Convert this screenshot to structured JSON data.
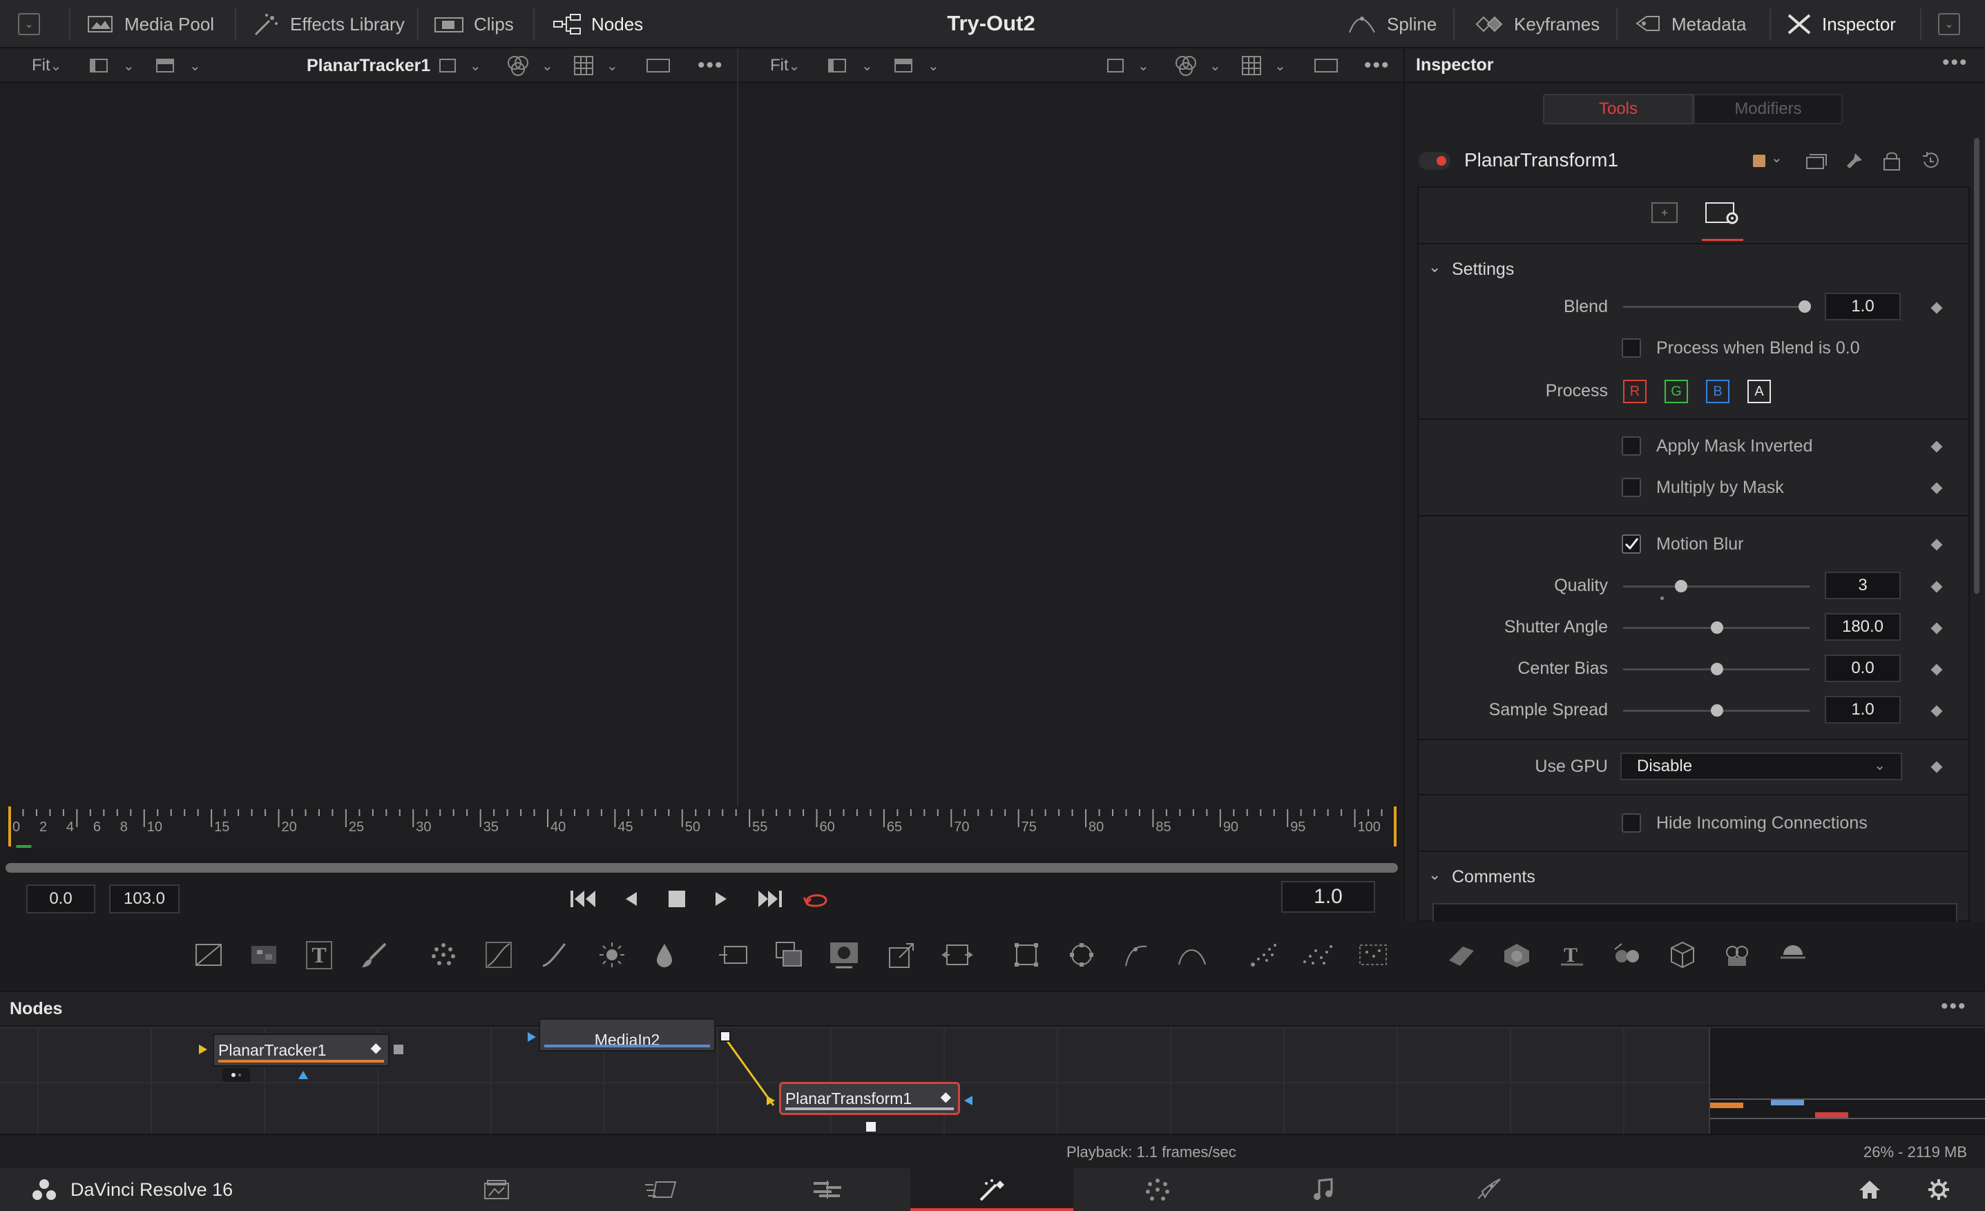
{
  "app": {
    "title": "Try-Out2",
    "name": "DaVinci Resolve 16"
  },
  "topbar": {
    "media_pool": "Media Pool",
    "effects_library": "Effects Library",
    "clips": "Clips",
    "nodes": "Nodes",
    "spline": "Spline",
    "keyframes": "Keyframes",
    "metadata": "Metadata",
    "inspector": "Inspector"
  },
  "viewer_left": {
    "fit": "Fit",
    "name": "PlanarTracker1"
  },
  "viewer_right": {
    "fit": "Fit"
  },
  "timeline": {
    "ticks": [
      "0",
      "2",
      "4",
      "6",
      "8",
      "10",
      "15",
      "20",
      "25",
      "30",
      "35",
      "40",
      "45",
      "50",
      "55",
      "60",
      "65",
      "70",
      "75",
      "80",
      "85",
      "90",
      "95",
      "100"
    ],
    "start": "0.0",
    "end": "103.0",
    "current": "1.0"
  },
  "nodes_panel": {
    "title": "Nodes",
    "nodes": [
      "PlanarTracker1",
      "MediaIn2",
      "PlanarTransform1"
    ]
  },
  "status": {
    "playback": "Playback: 1.1 frames/sec",
    "memory": "26% - 2119 MB"
  },
  "inspector": {
    "title": "Inspector",
    "tab_tools": "Tools",
    "tab_modifiers": "Modifiers",
    "tool_name": "PlanarTransform1",
    "settings_header": "Settings",
    "blend_label": "Blend",
    "blend_value": "1.0",
    "blend_level": 1.0,
    "process_when_blend": "Process when Blend is 0.0",
    "process_label": "Process",
    "channels": [
      "R",
      "G",
      "B",
      "A"
    ],
    "apply_mask_inverted": "Apply Mask Inverted",
    "multiply_by_mask": "Multiply by Mask",
    "motion_blur": "Motion Blur",
    "motion_blur_checked": true,
    "quality_label": "Quality",
    "quality_value": "3",
    "shutter_label": "Shutter Angle",
    "shutter_value": "180.0",
    "center_bias_label": "Center Bias",
    "center_bias_value": "0.0",
    "sample_spread_label": "Sample Spread",
    "sample_spread_value": "1.0",
    "use_gpu_label": "Use GPU",
    "use_gpu_value": "Disable",
    "hide_incoming": "Hide Incoming Connections",
    "comments_header": "Comments"
  },
  "colors": {
    "accent_red": "#e0403a",
    "selected_node_border": "#d0463e",
    "orange_bar": "#e08030",
    "blue_bar": "#5a8ac8"
  }
}
